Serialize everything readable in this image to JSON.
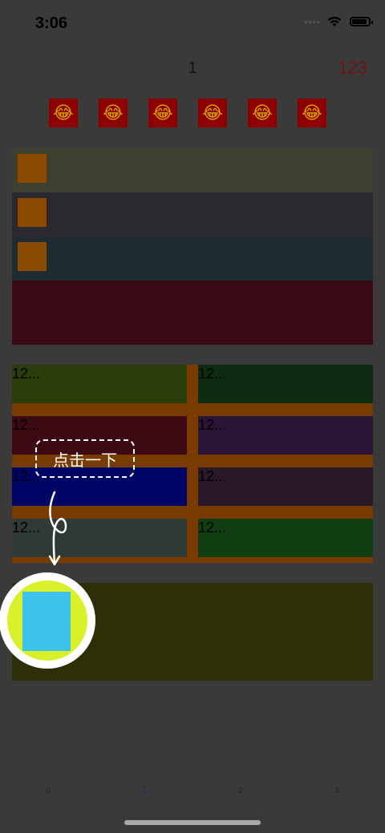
{
  "status_bar": {
    "time": "3:06"
  },
  "nav": {
    "title": "1",
    "right_label": "123"
  },
  "emoji_row": {
    "items": [
      "😂",
      "😂",
      "😂",
      "😂",
      "😂",
      "😂"
    ]
  },
  "list_rows": [
    {
      "color": "#3e3f2f",
      "has_thumb": true
    },
    {
      "color": "#2a292f",
      "has_thumb": true
    },
    {
      "color": "#1e2c31",
      "has_thumb": true
    },
    {
      "color": "#3a0b14",
      "has_thumb": false
    }
  ],
  "grid": {
    "cells": [
      {
        "label": "12...",
        "color": "#2c3d0c"
      },
      {
        "label": "12...",
        "color": "#0e2c12"
      },
      {
        "label": "12...",
        "color": "#3d0a14"
      },
      {
        "label": "12...",
        "color": "#2b1537"
      },
      {
        "label": "12...",
        "color": "#010565"
      },
      {
        "label": "12...",
        "color": "#28182a"
      },
      {
        "label": "12...",
        "color": "#2f3a34"
      },
      {
        "label": "12...",
        "color": "#103e12"
      }
    ]
  },
  "guide": {
    "tip_text": "点击一下"
  },
  "tabbar": {
    "tabs": [
      "0",
      "1",
      "2",
      "3"
    ],
    "active_index": 1
  }
}
